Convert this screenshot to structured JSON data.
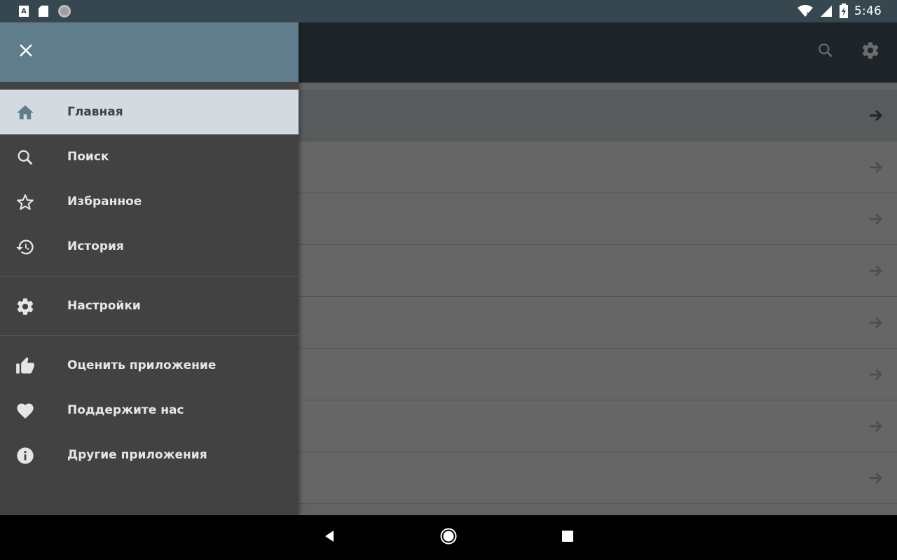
{
  "status_bar": {
    "time": "5:46",
    "left_icons": [
      "font-notification-icon",
      "sd-card-icon",
      "circle-notification-icon"
    ],
    "right_icons": [
      "wifi-icon",
      "signal-icon",
      "battery-charging-icon"
    ],
    "background": "#37474f"
  },
  "toolbar": {
    "actions": [
      "search-icon",
      "gear-icon"
    ],
    "background": "#455a64"
  },
  "drawer": {
    "close_icon": "close-icon",
    "header_color": "#607d8b",
    "items": [
      {
        "label": "Главная",
        "icon": "home-icon",
        "active": true
      },
      {
        "label": "Поиск",
        "icon": "search-icon"
      },
      {
        "label": "Избранное",
        "icon": "star-icon"
      },
      {
        "label": "История",
        "icon": "history-icon"
      },
      {
        "label": "Настройки",
        "icon": "gear-icon"
      },
      {
        "label": "Оценить приложение",
        "icon": "thumbs-up-icon"
      },
      {
        "label": "Поддержите нас",
        "icon": "heart-icon"
      },
      {
        "label": "Другие приложения",
        "icon": "info-icon"
      }
    ]
  },
  "content": {
    "rows": [
      {
        "arrow": "arrow-right-icon"
      },
      {
        "arrow": "arrow-right-icon"
      },
      {
        "arrow": "arrow-right-icon"
      },
      {
        "arrow": "arrow-right-icon"
      },
      {
        "arrow": "arrow-right-icon"
      },
      {
        "arrow": "arrow-right-icon"
      },
      {
        "arrow": "arrow-right-icon"
      },
      {
        "arrow": "arrow-right-icon"
      }
    ]
  },
  "nav_bar": {
    "buttons": [
      "back-icon",
      "home-circle-icon",
      "recents-icon"
    ]
  }
}
